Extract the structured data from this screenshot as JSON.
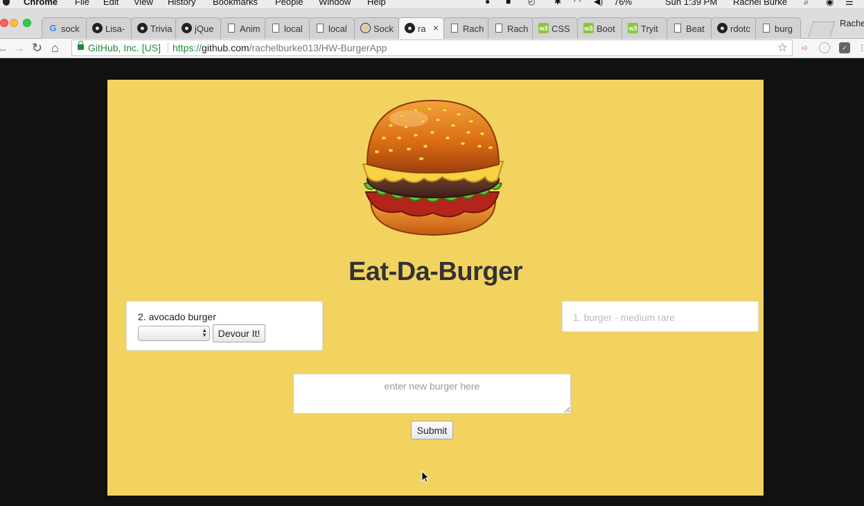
{
  "menubar": {
    "app": "Chrome",
    "items": [
      "File",
      "Edit",
      "View",
      "History",
      "Bookmarks",
      "People",
      "Window",
      "Help"
    ],
    "battery": "76%",
    "clock": "Sun 1:39 PM",
    "user": "Rachel Burke"
  },
  "tabs": [
    {
      "title": "sock",
      "icon": "google-icon"
    },
    {
      "title": "Lisa-",
      "icon": "github-icon"
    },
    {
      "title": "Trivia",
      "icon": "github-icon"
    },
    {
      "title": "jQue",
      "icon": "github-icon"
    },
    {
      "title": "Anim",
      "icon": "document-icon"
    },
    {
      "title": "local",
      "icon": "document-icon"
    },
    {
      "title": "local",
      "icon": "document-icon"
    },
    {
      "title": "Sock",
      "icon": "socket-icon"
    },
    {
      "title": "ra",
      "icon": "github-icon",
      "active": true
    },
    {
      "title": "Rach",
      "icon": "document-icon"
    },
    {
      "title": "Rach",
      "icon": "document-icon"
    },
    {
      "title": "CSS",
      "icon": "w3schools-icon"
    },
    {
      "title": "Boot",
      "icon": "w3schools-icon"
    },
    {
      "title": "Tryit",
      "icon": "w3schools-icon"
    },
    {
      "title": "Beat",
      "icon": "document-icon"
    },
    {
      "title": "rdotc",
      "icon": "github-icon"
    },
    {
      "title": "burg",
      "icon": "document-icon"
    }
  ],
  "profile_name": "Rache",
  "address_bar": {
    "org": "GitHub, Inc. [US]",
    "scheme": "https://",
    "host": "github.com",
    "path": "/rachelburke013/HW-BurgerApp"
  },
  "app": {
    "title": "Eat-Da-Burger",
    "uneaten_burger": "2. avocado burger",
    "devour_label": "Devour It!",
    "devoured_burger": "1. burger - medium rare",
    "new_burger_placeholder": "enter new burger here",
    "submit_label": "Submit"
  },
  "colors": {
    "page_background": "#f2d35f",
    "browser_background": "#111111",
    "address_secure_green": "#1e8a3a"
  }
}
